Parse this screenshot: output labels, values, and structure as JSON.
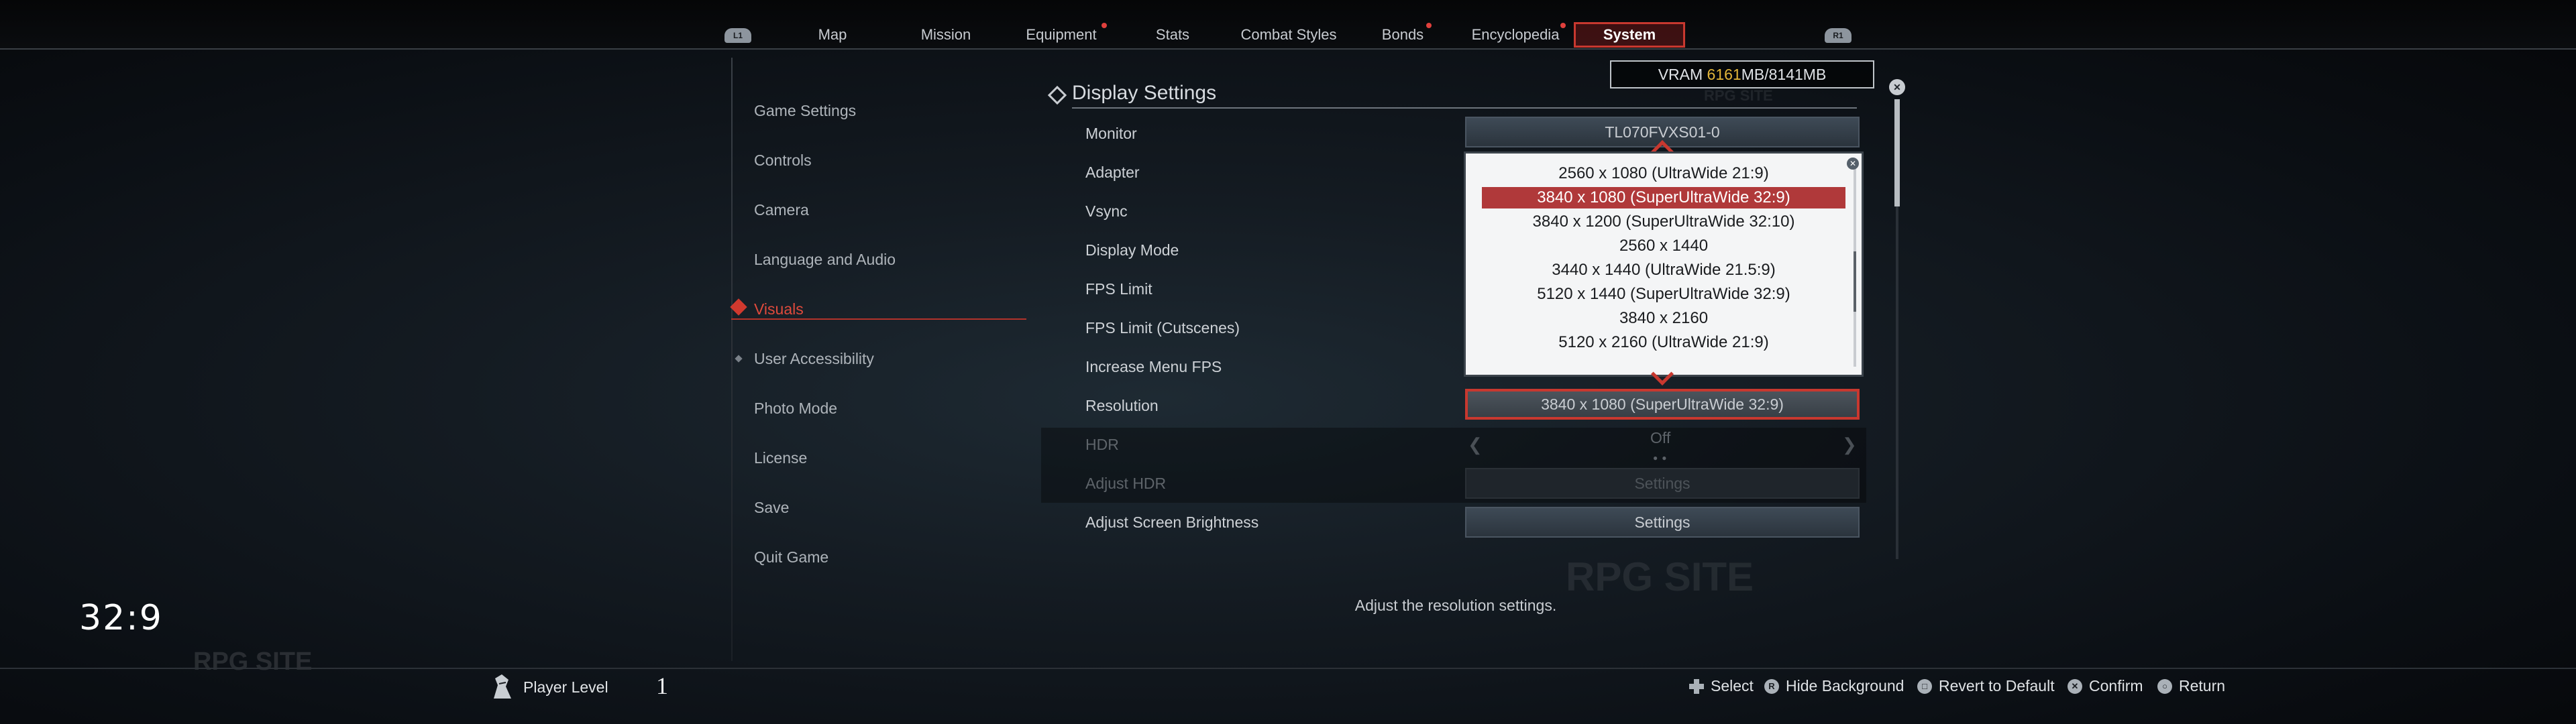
{
  "top_nav": {
    "left_shoulder": "L1",
    "right_shoulder": "R1",
    "tabs": [
      {
        "label": "Map",
        "notify": false
      },
      {
        "label": "Mission",
        "notify": false
      },
      {
        "label": "Equipment",
        "notify": true
      },
      {
        "label": "Stats",
        "notify": false
      },
      {
        "label": "Combat Styles",
        "notify": false
      },
      {
        "label": "Bonds",
        "notify": true
      },
      {
        "label": "Encyclopedia",
        "notify": true
      },
      {
        "label": "System",
        "notify": false,
        "active": true
      }
    ]
  },
  "vram": {
    "label": "VRAM",
    "used": "6161",
    "total": "8141",
    "unit": "MB"
  },
  "sidebar": {
    "items": [
      {
        "label": "Game Settings"
      },
      {
        "label": "Controls"
      },
      {
        "label": "Camera"
      },
      {
        "label": "Language and Audio"
      },
      {
        "label": "Visuals",
        "active": true
      },
      {
        "label": "User Accessibility"
      },
      {
        "label": "Photo Mode"
      },
      {
        "label": "License"
      },
      {
        "label": "Save"
      },
      {
        "label": "Quit Game"
      }
    ]
  },
  "section": {
    "title": "Display Settings"
  },
  "settings": {
    "monitor": {
      "label": "Monitor",
      "value": "TL070FVXS01-0"
    },
    "adapter": {
      "label": "Adapter"
    },
    "vsync": {
      "label": "Vsync"
    },
    "display_mode": {
      "label": "Display Mode"
    },
    "fps_limit": {
      "label": "FPS Limit"
    },
    "fps_limit_cutscenes": {
      "label": "FPS Limit (Cutscenes)"
    },
    "increase_menu_fps": {
      "label": "Increase Menu FPS"
    },
    "resolution": {
      "label": "Resolution",
      "value": "3840 x 1080 (SuperUltraWide 32:9)"
    },
    "hdr": {
      "label": "HDR",
      "value": "Off",
      "disabled": true
    },
    "adjust_hdr": {
      "label": "Adjust HDR",
      "value": "Settings",
      "disabled": true
    },
    "adjust_brightness": {
      "label": "Adjust Screen Brightness",
      "value": "Settings"
    }
  },
  "resolution_dropdown": {
    "options": [
      "2560 x 1080 (UltraWide 21:9)",
      "3840 x 1080 (SuperUltraWide 32:9)",
      "3840 x 1200 (SuperUltraWide 32:10)",
      "2560 x 1440",
      "3440 x 1440 (UltraWide 21.5:9)",
      "5120 x 1440 (SuperUltraWide 32:9)",
      "3840 x 2160",
      "5120 x 2160 (UltraWide 21:9)"
    ],
    "selected_index": 1
  },
  "help_text": "Adjust the resolution settings.",
  "overlay": {
    "aspect_label": "32:9",
    "watermark": "RPG SITE"
  },
  "footer": {
    "player_level_label": "Player Level",
    "player_level_value": "1",
    "hints": [
      {
        "glyph": "dpad-icon",
        "label": "Select"
      },
      {
        "glyph": "r-stick-icon",
        "label": "Hide Background"
      },
      {
        "glyph": "square-button-icon",
        "label": "Revert to Default"
      },
      {
        "glyph": "cross-button-icon",
        "label": "Confirm"
      },
      {
        "glyph": "circle-button-icon",
        "label": "Return"
      }
    ]
  },
  "colors": {
    "accent": "#c8382f",
    "vram_used": "#e3b63a",
    "dropdown_selected": "#b0393a"
  }
}
